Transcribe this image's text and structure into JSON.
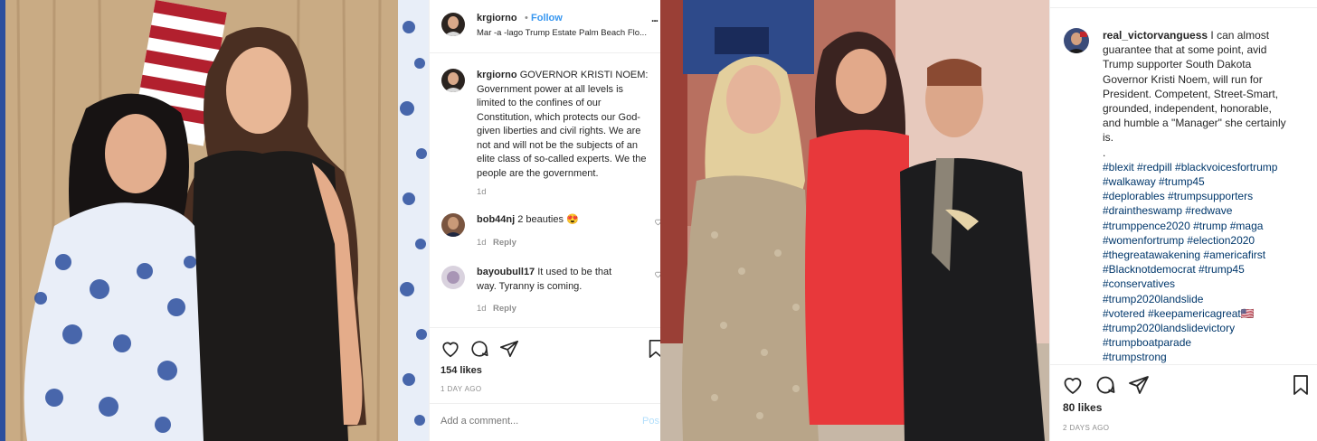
{
  "left_post": {
    "header": {
      "username": "krgiorno",
      "separator": "•",
      "follow_label": "Follow",
      "location": "Mar -a -lago Trump Estate Palm Beach Flo...",
      "more_label": "..."
    },
    "caption": {
      "username": "krgiorno",
      "lines": [
        "GOVERNOR KRISTI NOEM:",
        "Government power at all levels is",
        "limited to the confines of our",
        "Constitution, which protects our God-",
        "given liberties and civil rights. We are",
        "not and will not be the subjects of an",
        "elite class of so-called experts. We the",
        "people are the government."
      ],
      "time": "1d"
    },
    "comments": [
      {
        "username": "bob44nj",
        "text": "2 beauties 😍",
        "time": "1d",
        "reply_label": "Reply"
      },
      {
        "username": "bayoubull17",
        "text_lines": [
          "It used to be that",
          "way. Tyranny is coming."
        ],
        "time": "1d",
        "reply_label": "Reply"
      }
    ],
    "likes": "154 likes",
    "date": "1 DAY AGO",
    "comment_placeholder": "Add a comment...",
    "post_label": "Pos"
  },
  "right_post": {
    "caption": {
      "username": "real_victorvanguess",
      "lines": [
        "I can almost",
        "guarantee that at some point, avid",
        "Trump supporter South Dakota",
        "Governor Kristi Noem, will run for",
        "President. Competent, Street-Smart,",
        "grounded, independent, honorable,",
        "and humble a \"Manager\" she certainly",
        "is.",
        "."
      ],
      "hashtags": [
        "#blexit #redpill #blackvoicesfortrump",
        "#walkaway #trump45",
        "#deplorables #trumpsupporters",
        "#draintheswamp #redwave",
        "#trumppence2020 #trump #maga",
        "#womenfortrump #election2020",
        "#thegreatawakening #americafirst",
        "#Blacknotdemocrat #trump45",
        "#conservatives",
        "#trump2020landslide",
        "#votered #keepamericagreat🇺🇸",
        "#trump2020landslidevictory",
        "#trumpboatparade",
        "#trumpstrong"
      ]
    },
    "likes": "80 likes",
    "date": "2 DAYS AGO"
  },
  "icons": {
    "like": "heart-icon",
    "comment": "comment-icon",
    "share": "paper-plane-icon",
    "save": "bookmark-icon",
    "small_like": "small-heart-icon"
  },
  "colors": {
    "link_blue": "#3897f0",
    "hashtag": "#00376b",
    "muted": "#8e8e8e",
    "text": "#262626",
    "divider": "#efefef"
  }
}
